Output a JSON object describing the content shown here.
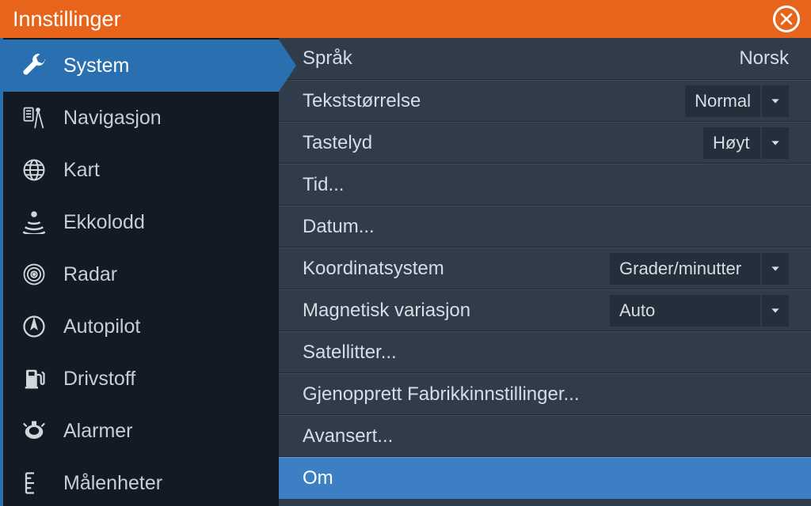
{
  "title": "Innstillinger",
  "sidebar": {
    "items": [
      {
        "label": "System"
      },
      {
        "label": "Navigasjon"
      },
      {
        "label": "Kart"
      },
      {
        "label": "Ekkolodd"
      },
      {
        "label": "Radar"
      },
      {
        "label": "Autopilot"
      },
      {
        "label": "Drivstoff"
      },
      {
        "label": "Alarmer"
      },
      {
        "label": "Målenheter"
      }
    ]
  },
  "content": {
    "rows": [
      {
        "label": "Språk",
        "value": "Norsk"
      },
      {
        "label": "Tekststørrelse",
        "value": "Normal"
      },
      {
        "label": "Tastelyd",
        "value": "Høyt"
      },
      {
        "label": "Tid..."
      },
      {
        "label": "Datum..."
      },
      {
        "label": "Koordinatsystem",
        "value": "Grader/minutter"
      },
      {
        "label": "Magnetisk variasjon",
        "value": "Auto"
      },
      {
        "label": "Satellitter..."
      },
      {
        "label": "Gjenopprett Fabrikkinnstillinger..."
      },
      {
        "label": "Avansert..."
      },
      {
        "label": "Om"
      }
    ]
  }
}
